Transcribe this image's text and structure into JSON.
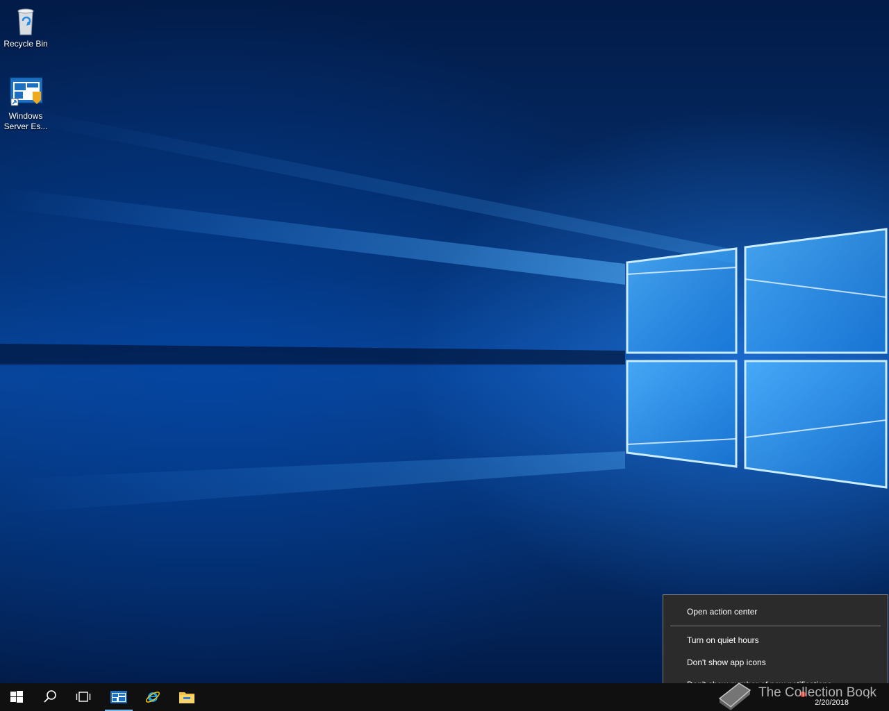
{
  "desktop": {
    "icons": [
      {
        "label": "Recycle Bin"
      },
      {
        "label_line1": "Windows",
        "label_line2": "Server Es..."
      }
    ]
  },
  "taskbar": {
    "start": "windows-logo-icon",
    "search": "search-icon",
    "task_view": "task-view-icon",
    "pinned": [
      "server-essentials-dashboard-icon",
      "internet-explorer-icon",
      "file-explorer-icon"
    ],
    "clock_date": "2/20/2018",
    "accent_color": "#76b9ed"
  },
  "context_menu": {
    "items": [
      {
        "label": "Open action center"
      },
      {
        "label": "Turn on quiet hours"
      },
      {
        "label": "Don't show app icons"
      },
      {
        "label": "Don't show number of new notifications"
      }
    ]
  },
  "watermark": {
    "text": "The Collection Book"
  },
  "colors": {
    "menu_background": "#2b2b2b",
    "taskbar_background": "#101010",
    "wallpaper_blue": "#0a4495"
  }
}
